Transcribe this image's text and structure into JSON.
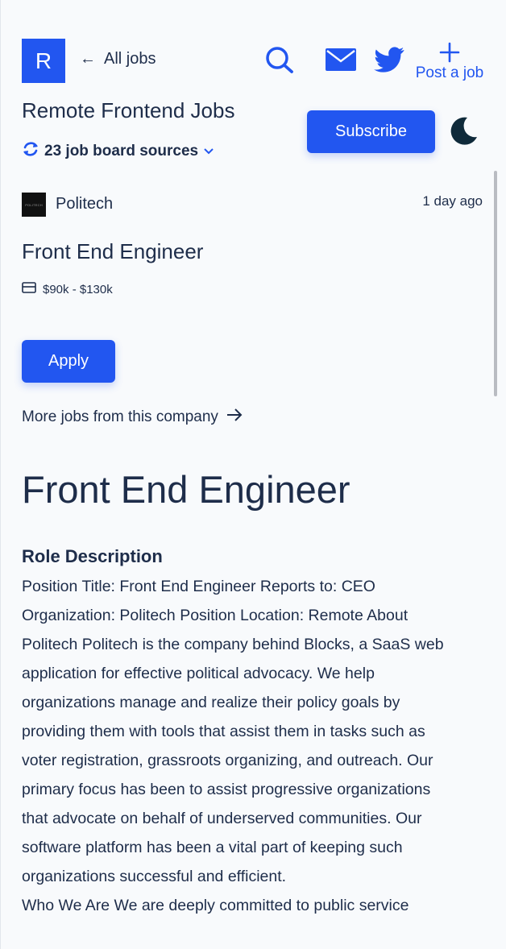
{
  "header": {
    "logo_letter": "R",
    "all_jobs_label": "All jobs",
    "post_job_label": "Post a job",
    "page_title": "Remote Frontend Jobs",
    "sources_label": "23 job board sources",
    "subscribe_label": "Subscribe"
  },
  "job": {
    "company_logo_text": "POLITECH",
    "company": "Politech",
    "posted": "1 day ago",
    "title": "Front End Engineer",
    "salary": "$90k - $130k",
    "apply_label": "Apply",
    "more_jobs_label": "More jobs from this company"
  },
  "description": {
    "heading": "Front End Engineer",
    "section_title": "Role Description",
    "paragraph_1": "Position Title: Front End Engineer Reports to: CEO Organization: Politech Position Location: Remote About Politech Politech is the company behind Blocks, a SaaS web application for effective political advocacy. We help organizations manage and realize their policy goals by providing them with tools that assist them in tasks such as voter registration, grassroots organizing, and outreach. Our primary focus has been to assist progressive organizations that advocate on behalf of underserved communities. Our software platform has been a vital part of keeping such organizations successful and efficient.",
    "paragraph_2": "Who We Are We are deeply committed to public service"
  },
  "colors": {
    "accent": "#2256f0",
    "text": "#1e2d4a",
    "background": "#f8fafc",
    "moon": "#0f2a3a"
  }
}
